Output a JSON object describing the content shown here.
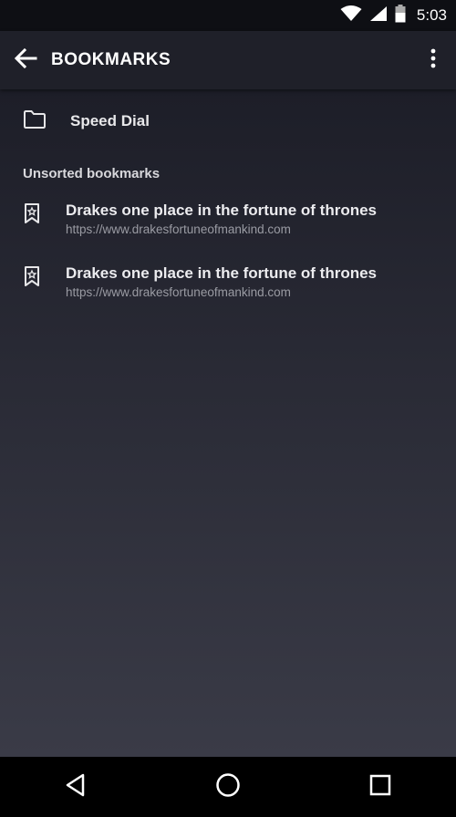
{
  "status": {
    "time": "5:03",
    "icons": [
      "wifi-icon",
      "signal-icon",
      "battery-icon"
    ]
  },
  "appbar": {
    "title": "BOOKMARKS",
    "back_icon": "arrow-left-icon",
    "menu_icon": "more-vert-icon"
  },
  "speed_dial": {
    "label": "Speed Dial",
    "icon": "folder-icon"
  },
  "section": {
    "header": "Unsorted bookmarks"
  },
  "bookmarks": [
    {
      "title": "Drakes one place in the fortune of thrones",
      "url": "https://www.drakesfortuneofmankind.com",
      "icon": "bookmark-icon"
    },
    {
      "title": "Drakes one place in the fortune of thrones",
      "url": "https://www.drakesfortuneofmankind.com",
      "icon": "bookmark-icon"
    }
  ],
  "navbar": {
    "icons": [
      "back-triangle-icon",
      "home-circle-icon",
      "recents-square-icon"
    ]
  },
  "colors": {
    "appbar": "#1f2029",
    "status": "#0e0f14",
    "content_top": "#1d1e28",
    "content_bottom": "#3a3b47"
  }
}
